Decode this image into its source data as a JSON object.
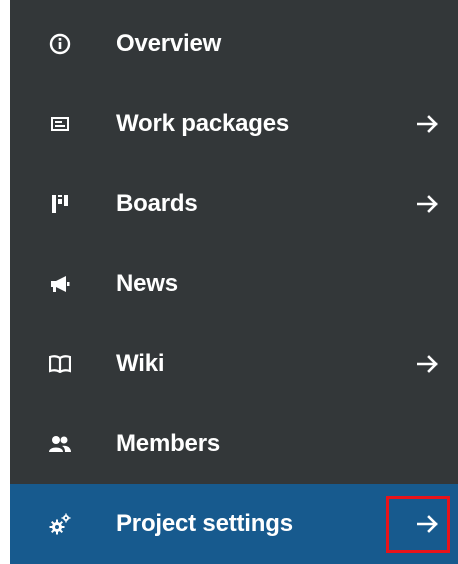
{
  "menu": {
    "items": [
      {
        "label": "Overview",
        "icon": "info-circle-icon",
        "has_arrow": false
      },
      {
        "label": "Work packages",
        "icon": "work-packages-icon",
        "has_arrow": true
      },
      {
        "label": "Boards",
        "icon": "boards-icon",
        "has_arrow": true
      },
      {
        "label": "News",
        "icon": "news-megaphone-icon",
        "has_arrow": false
      },
      {
        "label": "Wiki",
        "icon": "wiki-book-icon",
        "has_arrow": true
      },
      {
        "label": "Members",
        "icon": "members-icon",
        "has_arrow": false
      },
      {
        "label": "Project settings",
        "icon": "settings-gears-icon",
        "has_arrow": true,
        "active": true
      }
    ]
  },
  "colors": {
    "sidebar_bg": "#333739",
    "active_bg": "#175a8e",
    "text": "#ffffff",
    "highlight": "#e8131a"
  }
}
